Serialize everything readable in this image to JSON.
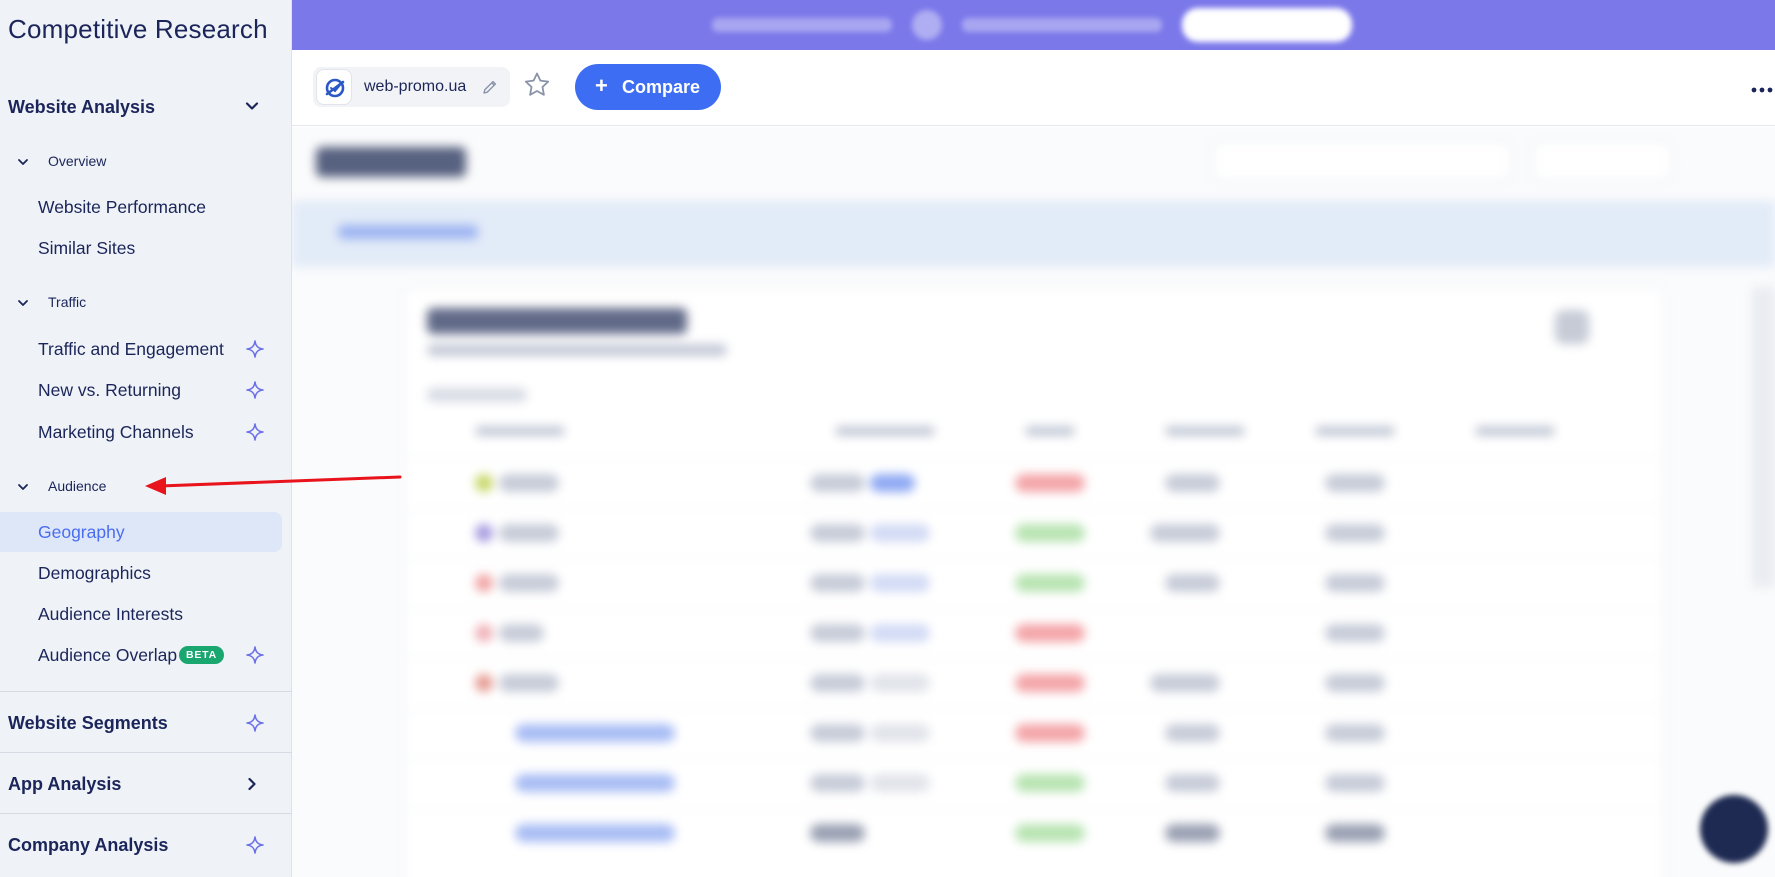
{
  "sidebar": {
    "app_title": "Competitive Research",
    "website_analysis": "Website Analysis",
    "overview": {
      "label": "Overview",
      "items": [
        "Website Performance",
        "Similar Sites"
      ]
    },
    "traffic": {
      "label": "Traffic",
      "items": [
        "Traffic and Engagement",
        "New vs. Returning",
        "Marketing Channels"
      ]
    },
    "audience": {
      "label": "Audience",
      "items": [
        "Geography",
        "Demographics",
        "Audience Interests",
        "Audience Overlap"
      ],
      "active_item": "Geography",
      "beta_label": "BETA"
    },
    "website_segments": "Website Segments",
    "app_analysis": "App Analysis",
    "company_analysis": "Company Analysis"
  },
  "header": {
    "domain": "web-promo.ua",
    "compare_label": "Compare",
    "compare_plus": "+"
  },
  "colors": {
    "accent": "#3d6df2",
    "promo_bar": "#7b78ea",
    "sidebar_bg": "#eff3f8",
    "active_item_bg": "#dde7f8",
    "beta_badge": "#1aa66f",
    "annotation_arrow": "#e8131b"
  },
  "icons": {
    "section_expanded": "chevron-down-icon",
    "section_collapsed": "chevron-right-icon",
    "ai_feature": "sparkle-icon",
    "edit": "pencil-icon",
    "favorite": "star-icon",
    "more": "more-dots-icon"
  }
}
